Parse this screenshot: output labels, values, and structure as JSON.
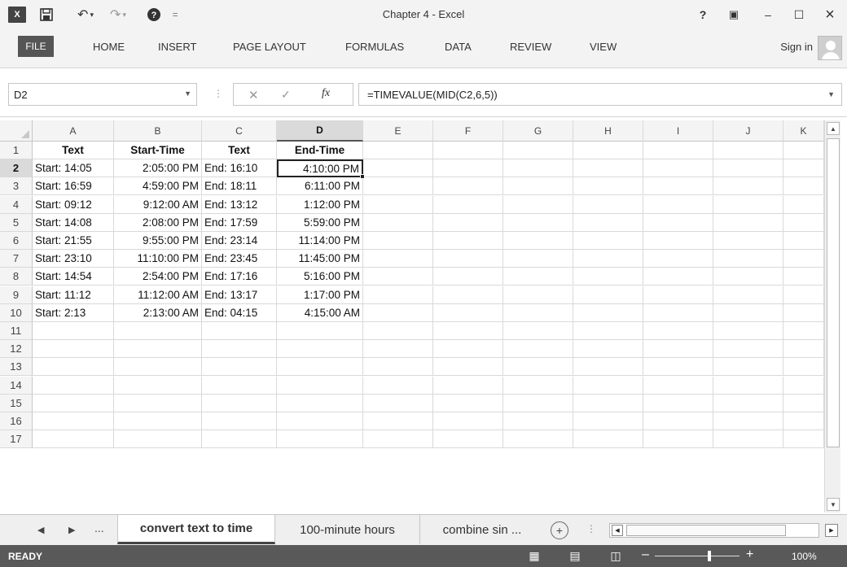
{
  "window": {
    "title": "Chapter 4 - Excel",
    "app_logo": "X"
  },
  "title_icons": {
    "help": "?",
    "restore_ribbon": "▣",
    "minimize": "–",
    "maximize": "☐",
    "close": "×"
  },
  "ribbon_tabs": [
    "FILE",
    "HOME",
    "INSERT",
    "PAGE LAYOUT",
    "FORMULAS",
    "DATA",
    "REVIEW",
    "VIEW"
  ],
  "account": {
    "sign_in": "Sign in"
  },
  "formula_bar": {
    "name_box": "D2",
    "formula": "=TIMEVALUE(MID(C2,6,5))",
    "fx": "fx"
  },
  "columns": [
    "A",
    "B",
    "C",
    "D",
    "E",
    "F",
    "G",
    "H",
    "I",
    "J",
    "K"
  ],
  "rows": [
    "1",
    "2",
    "3",
    "4",
    "5",
    "6",
    "7",
    "8",
    "9",
    "10",
    "11",
    "12",
    "13",
    "14",
    "15",
    "16",
    "17"
  ],
  "header_row": [
    "Text",
    "Start-Time",
    "Text",
    "End-Time"
  ],
  "data_rows": [
    [
      "Start: 14:05",
      "2:05:00 PM",
      "End: 16:10",
      "4:10:00 PM"
    ],
    [
      "Start: 16:59",
      "4:59:00 PM",
      "End: 18:11",
      "6:11:00 PM"
    ],
    [
      "Start: 09:12",
      "9:12:00 AM",
      "End: 13:12",
      "1:12:00 PM"
    ],
    [
      "Start: 14:08",
      "2:08:00 PM",
      "End: 17:59",
      "5:59:00 PM"
    ],
    [
      "Start: 21:55",
      "9:55:00 PM",
      "End: 23:14",
      "11:14:00 PM"
    ],
    [
      "Start: 23:10",
      "11:10:00 PM",
      "End: 23:45",
      "11:45:00 PM"
    ],
    [
      "Start: 14:54",
      "2:54:00 PM",
      "End: 17:16",
      "5:16:00 PM"
    ],
    [
      "Start: 11:12",
      "11:12:00 AM",
      "End: 13:17",
      "1:17:00 PM"
    ],
    [
      "Start: 2:13",
      "2:13:00 AM",
      "End: 04:15",
      "4:15:00 AM"
    ]
  ],
  "selection": {
    "column": "D",
    "row": "2"
  },
  "sheet_tabs": {
    "ellipsis": "...",
    "active": "convert text to time",
    "second": "100-minute hours",
    "third": "combine sin ...",
    "add": "+"
  },
  "status": {
    "mode": "READY",
    "zoom": "100%",
    "zoom_fraction": 0.64
  }
}
